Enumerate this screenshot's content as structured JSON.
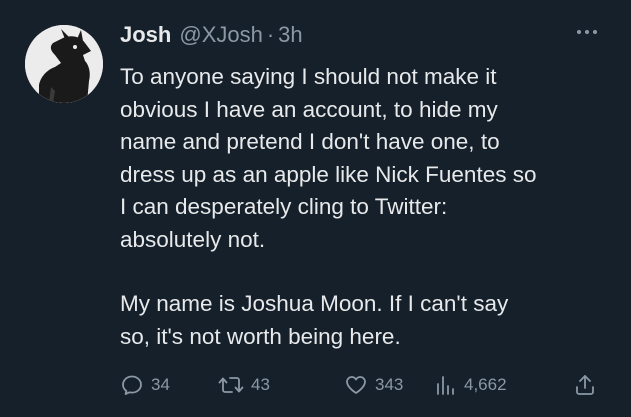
{
  "tweet": {
    "author_name": "Josh",
    "handle": "@XJosh",
    "separator": "·",
    "time": "3h",
    "more_icon": "more-dots-icon",
    "lines": [
      "To anyone saying I should not make it",
      "obvious I have an account, to hide my",
      "name and pretend I don't have one, to",
      "dress up as an apple like Nick Fuentes so",
      "I can desperately cling to Twitter:",
      "absolutely not.",
      "",
      "My name is Joshua Moon. If I can't say",
      "so, it's not worth being here."
    ]
  },
  "actions": {
    "reply": {
      "icon": "reply-icon",
      "count": "34"
    },
    "retweet": {
      "icon": "retweet-icon",
      "count": "43"
    },
    "like": {
      "icon": "heart-icon",
      "count": "343"
    },
    "views": {
      "icon": "views-icon",
      "count": "4,662"
    },
    "share": {
      "icon": "share-icon"
    }
  },
  "colors": {
    "background": "#15202b",
    "text": "#e7e9ea",
    "muted": "#8b98a5"
  }
}
